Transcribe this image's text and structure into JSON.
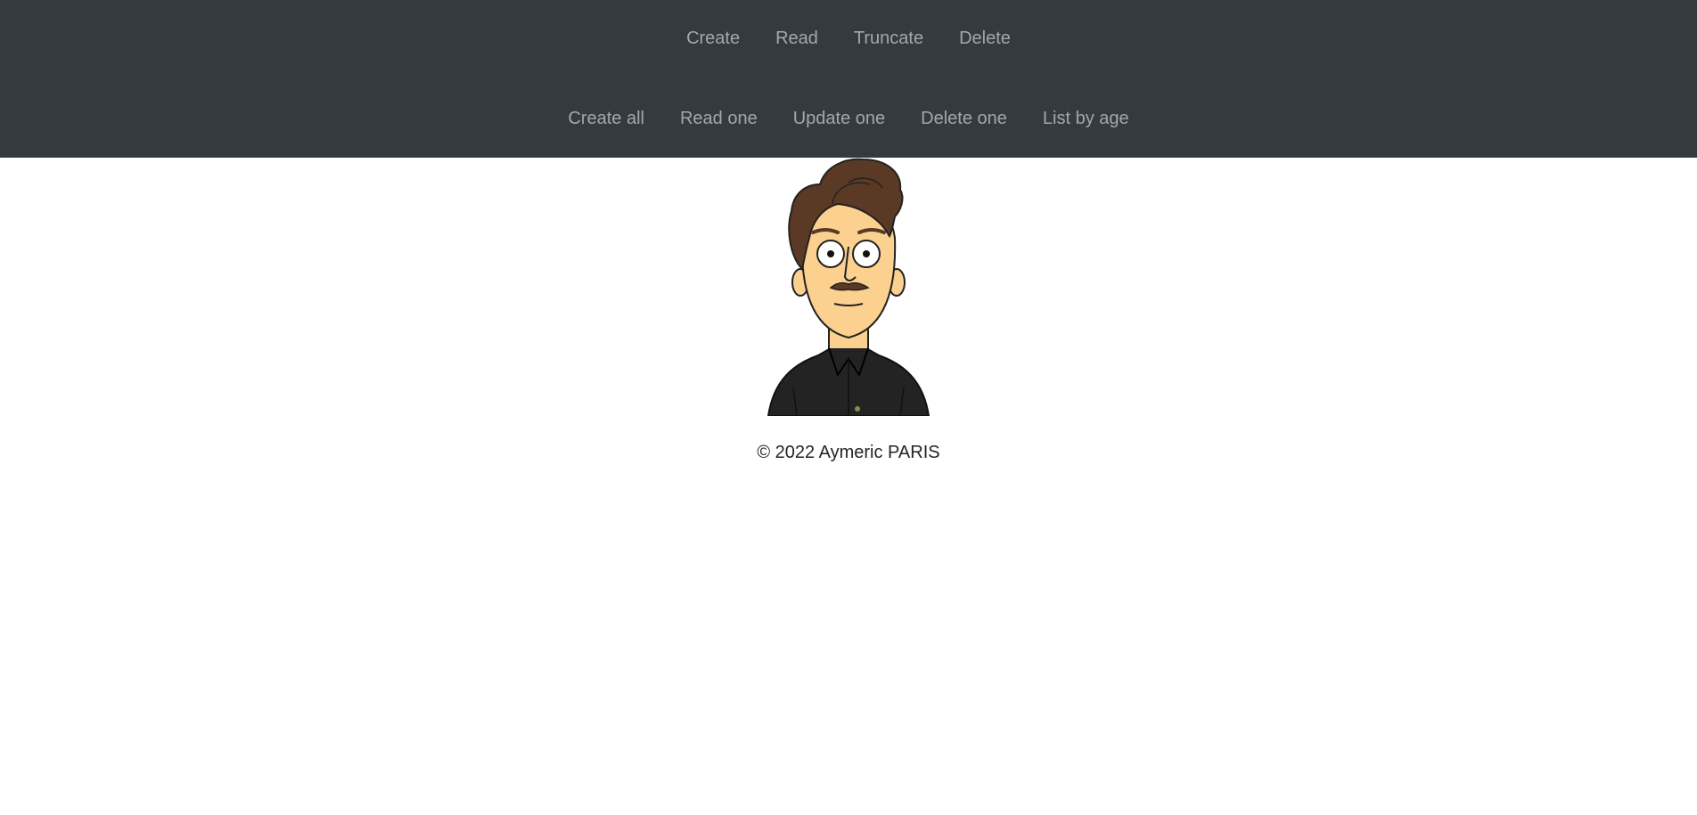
{
  "nav": {
    "row1": [
      {
        "label": "Create"
      },
      {
        "label": "Read"
      },
      {
        "label": "Truncate"
      },
      {
        "label": "Delete"
      }
    ],
    "row2": [
      {
        "label": "Create all"
      },
      {
        "label": "Read one"
      },
      {
        "label": "Update one"
      },
      {
        "label": "Delete one"
      },
      {
        "label": "List by age"
      }
    ]
  },
  "avatar": {
    "icon": "cartoon-man-avatar"
  },
  "footer": {
    "copyright": "© 2022 Aymeric PARIS"
  },
  "colors": {
    "navbar": "#343a40",
    "nav_link": "rgba(255,255,255,0.55)",
    "background": "#ffffff"
  }
}
